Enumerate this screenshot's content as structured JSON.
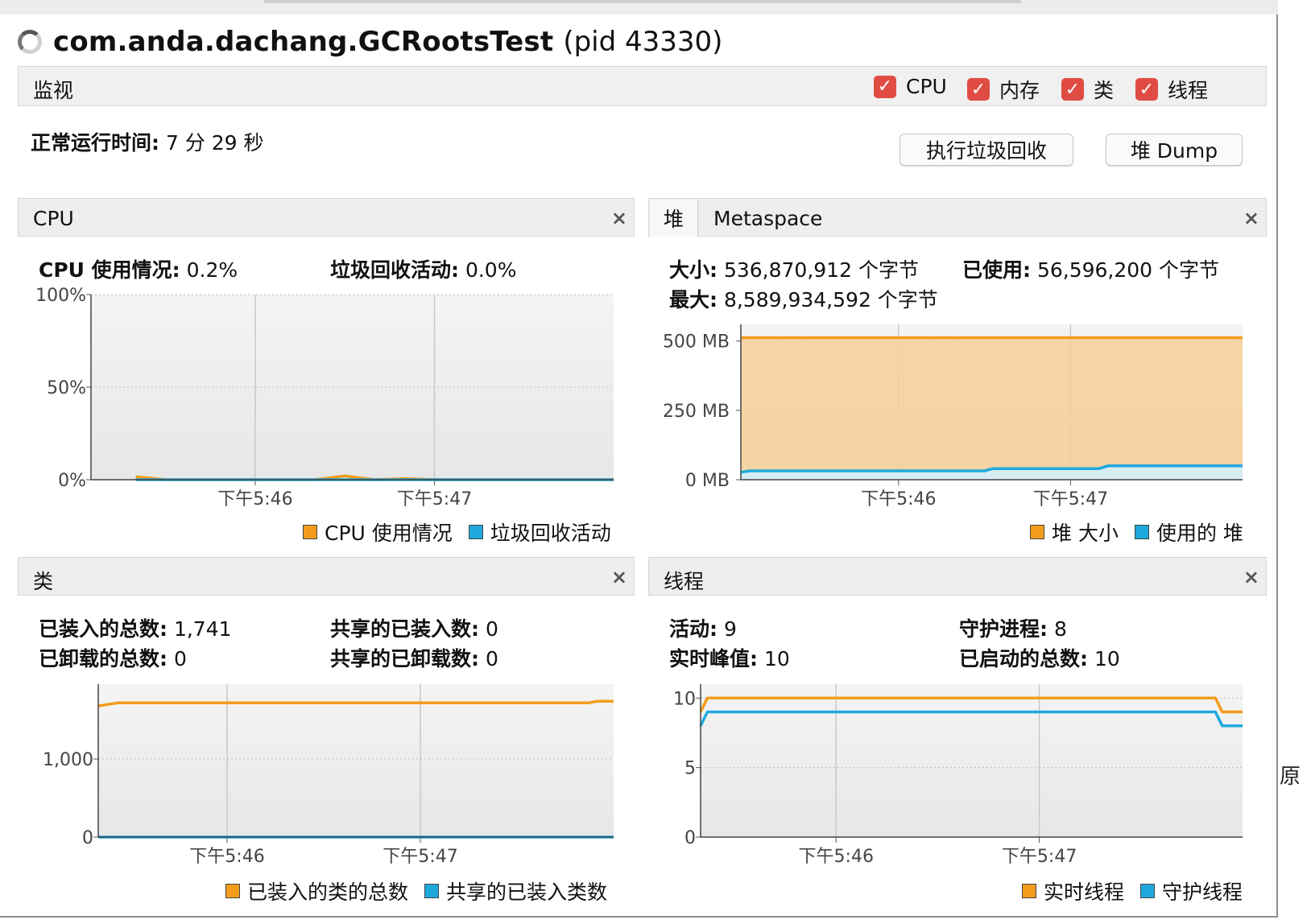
{
  "title": {
    "app_name": "com.anda.dachang.GCRootsTest",
    "pid": "(pid 43330)"
  },
  "outside_fragment": "原",
  "monitor": {
    "label": "监视",
    "checkboxes": [
      {
        "label": "CPU",
        "checked": true
      },
      {
        "label": "内存",
        "checked": true
      },
      {
        "label": "类",
        "checked": true
      },
      {
        "label": "线程",
        "checked": true
      }
    ]
  },
  "uptime": {
    "label": "正常运行时间:",
    "value": "7 分 29 秒"
  },
  "buttons": {
    "gc": "执行垃圾回收",
    "heap_dump": "堆 Dump"
  },
  "colors": {
    "orange": "#f39c1c",
    "blue": "#1ea9dd",
    "checkbox_red": "#e04c43"
  },
  "cpu_panel": {
    "title": "CPU",
    "close": "×",
    "usage_label": "CPU 使用情况:",
    "usage_value": "0.2%",
    "gc_label": "垃圾回收活动:",
    "gc_value": "0.0%",
    "legend": [
      "CPU 使用情况",
      "垃圾回收活动"
    ]
  },
  "heap_panel": {
    "tab_heap": "堆",
    "tab_metaspace": "Metaspace",
    "close": "×",
    "size_label": "大小:",
    "size_value": "536,870,912 个字节",
    "used_label": "已使用:",
    "used_value": "56,596,200 个字节",
    "max_label": "最大:",
    "max_value": "8,589,934,592 个字节",
    "legend": [
      "堆 大小",
      "使用的 堆"
    ]
  },
  "classes_panel": {
    "title": "类",
    "close": "×",
    "loaded_label": "已装入的总数:",
    "loaded_value": "1,741",
    "shared_loaded_label": "共享的已装入数:",
    "shared_loaded_value": "0",
    "unloaded_label": "已卸载的总数:",
    "unloaded_value": "0",
    "shared_unloaded_label": "共享的已卸载数:",
    "shared_unloaded_value": "0",
    "legend": [
      "已装入的类的总数",
      "共享的已装入类数"
    ]
  },
  "threads_panel": {
    "title": "线程",
    "close": "×",
    "live_label": "活动:",
    "live_value": "9",
    "daemon_label": "守护进程:",
    "daemon_value": "8",
    "peak_label": "实时峰值:",
    "peak_value": "10",
    "started_label": "已启动的总数:",
    "started_value": "10",
    "legend": [
      "实时线程",
      "守护线程"
    ]
  },
  "chart_data": [
    {
      "id": "cpu",
      "type": "line",
      "x": [
        "17:45:20",
        "17:45:30",
        "17:45:40",
        "17:45:50",
        "17:46:00",
        "17:46:10",
        "17:46:20",
        "17:46:30",
        "17:46:40",
        "17:46:50",
        "17:47:00",
        "17:47:10",
        "17:47:20",
        "17:47:30",
        "17:47:40",
        "17:47:50",
        "17:48:00"
      ],
      "xlim": [
        "17:45:05",
        "17:48:00"
      ],
      "x_ticks": [
        {
          "x": "17:46:00",
          "label": "下午5:46"
        },
        {
          "x": "17:47:00",
          "label": "下午5:47"
        }
      ],
      "ylim": [
        0,
        100
      ],
      "y_ticks": [
        {
          "y": 0,
          "label": "0%"
        },
        {
          "y": 50,
          "label": "50%"
        },
        {
          "y": 100,
          "label": "100%"
        }
      ],
      "series": [
        {
          "name": "CPU 使用情况",
          "color": "orange",
          "values": [
            1.6,
            0,
            0,
            0,
            0,
            0,
            0,
            2.0,
            0,
            0.6,
            0,
            0,
            0,
            0,
            0,
            0,
            0
          ]
        },
        {
          "name": "垃圾回收活动",
          "color": "blue",
          "values": [
            0,
            0,
            0,
            0,
            0,
            0,
            0,
            0,
            0,
            0,
            0,
            0,
            0,
            0,
            0,
            0,
            0
          ]
        }
      ]
    },
    {
      "id": "heap",
      "type": "area",
      "x": [
        "17:45:05",
        "17:45:08",
        "17:46:30",
        "17:46:33",
        "17:47:10",
        "17:47:13",
        "17:48:00"
      ],
      "xlim": [
        "17:45:05",
        "17:48:00"
      ],
      "x_ticks": [
        {
          "x": "17:46:00",
          "label": "下午5:46"
        },
        {
          "x": "17:47:00",
          "label": "下午5:47"
        }
      ],
      "ylim": [
        0,
        560
      ],
      "y_unit": "MB",
      "y_ticks": [
        {
          "y": 0,
          "label": "0 MB"
        },
        {
          "y": 250,
          "label": "250 MB"
        },
        {
          "y": 500,
          "label": "500 MB"
        }
      ],
      "series": [
        {
          "name": "堆 大小",
          "color": "orange",
          "values": [
            512,
            512,
            512,
            512,
            512,
            512,
            512
          ]
        },
        {
          "name": "使用的 堆",
          "color": "blue",
          "values": [
            27,
            32,
            32,
            40,
            40,
            50,
            50
          ]
        }
      ]
    },
    {
      "id": "classes",
      "type": "line",
      "x": [
        "17:45:20",
        "17:45:23",
        "17:45:26",
        "17:47:52",
        "17:47:55",
        "17:48:00"
      ],
      "xlim": [
        "17:45:20",
        "17:48:00"
      ],
      "x_ticks": [
        {
          "x": "17:46:00",
          "label": "下午5:46"
        },
        {
          "x": "17:47:00",
          "label": "下午5:47"
        }
      ],
      "ylim": [
        0,
        1960
      ],
      "y_ticks": [
        {
          "y": 0,
          "label": "0"
        },
        {
          "y": 1000,
          "label": "1,000"
        }
      ],
      "series": [
        {
          "name": "已装入的类的总数",
          "color": "orange",
          "values": [
            1680,
            1700,
            1720,
            1720,
            1741,
            1741
          ]
        },
        {
          "name": "共享的已装入类数",
          "color": "blue",
          "values": [
            0,
            0,
            0,
            0,
            0,
            0
          ]
        }
      ]
    },
    {
      "id": "threads",
      "type": "line",
      "x": [
        "17:45:20",
        "17:45:22",
        "17:47:52",
        "17:47:54",
        "17:48:00"
      ],
      "xlim": [
        "17:45:20",
        "17:48:00"
      ],
      "x_ticks": [
        {
          "x": "17:46:00",
          "label": "下午5:46"
        },
        {
          "x": "17:47:00",
          "label": "下午5:47"
        }
      ],
      "ylim": [
        0,
        11
      ],
      "y_ticks": [
        {
          "y": 0,
          "label": "0"
        },
        {
          "y": 5,
          "label": "5"
        },
        {
          "y": 10,
          "label": "10"
        }
      ],
      "series": [
        {
          "name": "实时线程",
          "color": "orange",
          "values": [
            9,
            10,
            10,
            9,
            9
          ]
        },
        {
          "name": "守护线程",
          "color": "blue",
          "values": [
            8,
            9,
            9,
            8,
            8
          ]
        }
      ]
    }
  ]
}
